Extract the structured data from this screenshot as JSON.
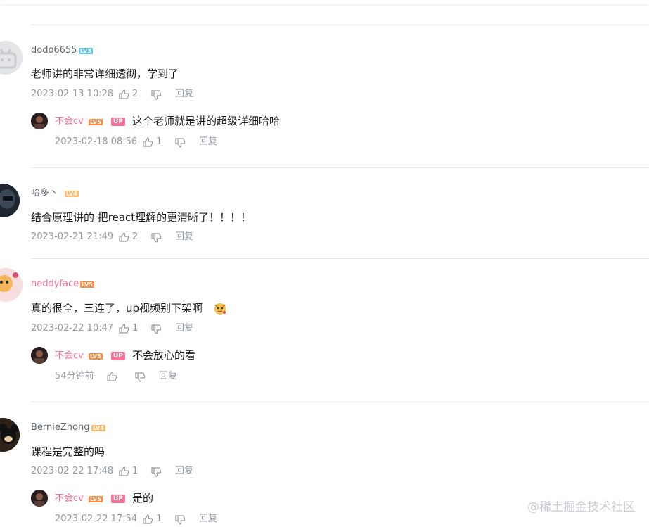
{
  "colors": {
    "up_pink": "#fb7299",
    "lv3": "#61c8e4",
    "lv4": "#feba6a",
    "lv5": "#ff8c42",
    "meta_gray": "#9499a0",
    "divider": "#e3e5e7"
  },
  "up_label": "UP",
  "reply_label": "回复",
  "watermark": "@稀土掘金技术社区",
  "comments": [
    {
      "user": "dodo6655",
      "level": "LV3",
      "content": "老师讲的非常详细透彻，学到了",
      "time": "2023-02-13 10:28",
      "likes": "2",
      "reply": {
        "user": "不会cv",
        "level": "LV5",
        "content": "这个老师就是讲的超级详细哈哈",
        "time": "2023-02-18 08:56",
        "likes": "1"
      }
    },
    {
      "user": "哈多丶",
      "level": "LV4",
      "content": "结合原理讲的 把react理解的更清晰了！！！！",
      "time": "2023-02-21 21:49",
      "likes": "2"
    },
    {
      "user": "neddyface",
      "level": "LV5",
      "content": "真的很全，三连了，up视频别下架啊",
      "time": "2023-02-22 10:47",
      "likes": "1",
      "reply": {
        "user": "不会cv",
        "level": "LV5",
        "content": "不会放心的看",
        "time": "54分钟前",
        "likes": ""
      }
    },
    {
      "user": "BernieZhong",
      "level": "LV4",
      "content": "课程是完整的吗",
      "time": "2023-02-22 17:48",
      "likes": "1",
      "reply": {
        "user": "不会cv",
        "level": "LV5",
        "content": "是的",
        "time": "2023-02-22 17:54",
        "likes": "1"
      }
    }
  ]
}
